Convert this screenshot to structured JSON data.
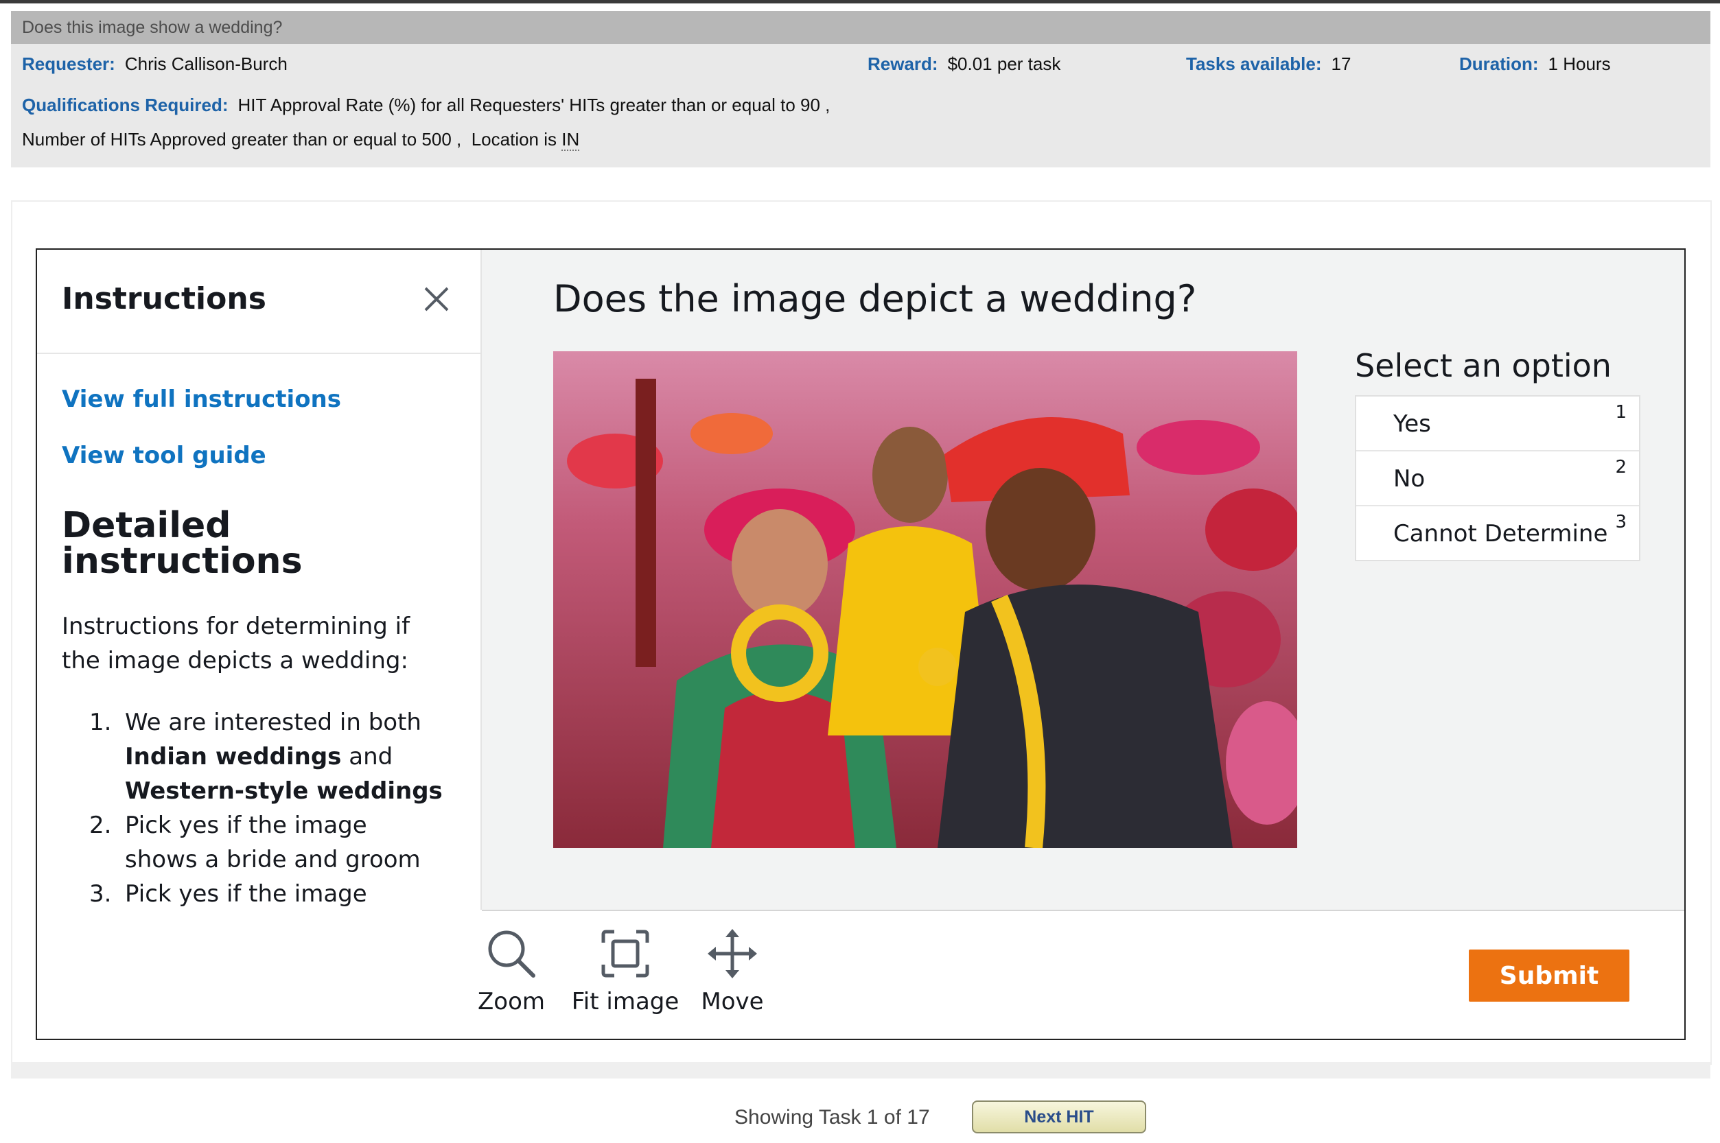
{
  "hit": {
    "title": "Does this image show a wedding?",
    "requester_label": "Requester:",
    "requester": "Chris Callison-Burch",
    "reward_label": "Reward:",
    "reward": "$0.01 per task",
    "tasks_label": "Tasks available:",
    "tasks": "17",
    "duration_label": "Duration:",
    "duration": "1 Hours",
    "quals_label": "Qualifications Required:",
    "qual_1": "HIT Approval Rate (%) for all Requesters' HITs greater than or equal to 90 ,",
    "qual_2": "Number of HITs Approved greater than or equal to 500 ,",
    "qual_3_prefix": "Location is",
    "qual_3_value": "IN"
  },
  "instructions": {
    "title": "Instructions",
    "link_full": "View full instructions",
    "link_guide": "View tool guide",
    "heading": "Detailed instructions",
    "intro": "Instructions for determining if the image depicts a wedding:",
    "items": [
      {
        "num": "1.",
        "pre": "We are interested in both ",
        "b1": "Indian weddings",
        "mid": " and ",
        "b2": "Western-style weddings",
        "post": ""
      },
      {
        "num": "2.",
        "text": "Pick yes if the image shows a bride and groom"
      },
      {
        "num": "3.",
        "text": "Pick yes if the image"
      }
    ]
  },
  "task": {
    "question": "Does the image depict a wedding?",
    "options_title": "Select an option",
    "options": [
      {
        "label": "Yes",
        "key": "1"
      },
      {
        "label": "No",
        "key": "2"
      },
      {
        "label": "Cannot Determine",
        "key": "3"
      }
    ]
  },
  "toolbar": {
    "zoom": "Zoom",
    "fit": "Fit image",
    "move": "Move",
    "submit": "Submit",
    "zoom_icon": "magnifier-icon",
    "fit_icon": "fit-frame-icon",
    "move_icon": "four-arrows-icon"
  },
  "footer": {
    "status": "Showing Task 1 of 17",
    "next": "Next HIT"
  },
  "colors": {
    "link": "#0f73c0",
    "submit": "#ec7211",
    "requester_label": "#1e63a8"
  }
}
